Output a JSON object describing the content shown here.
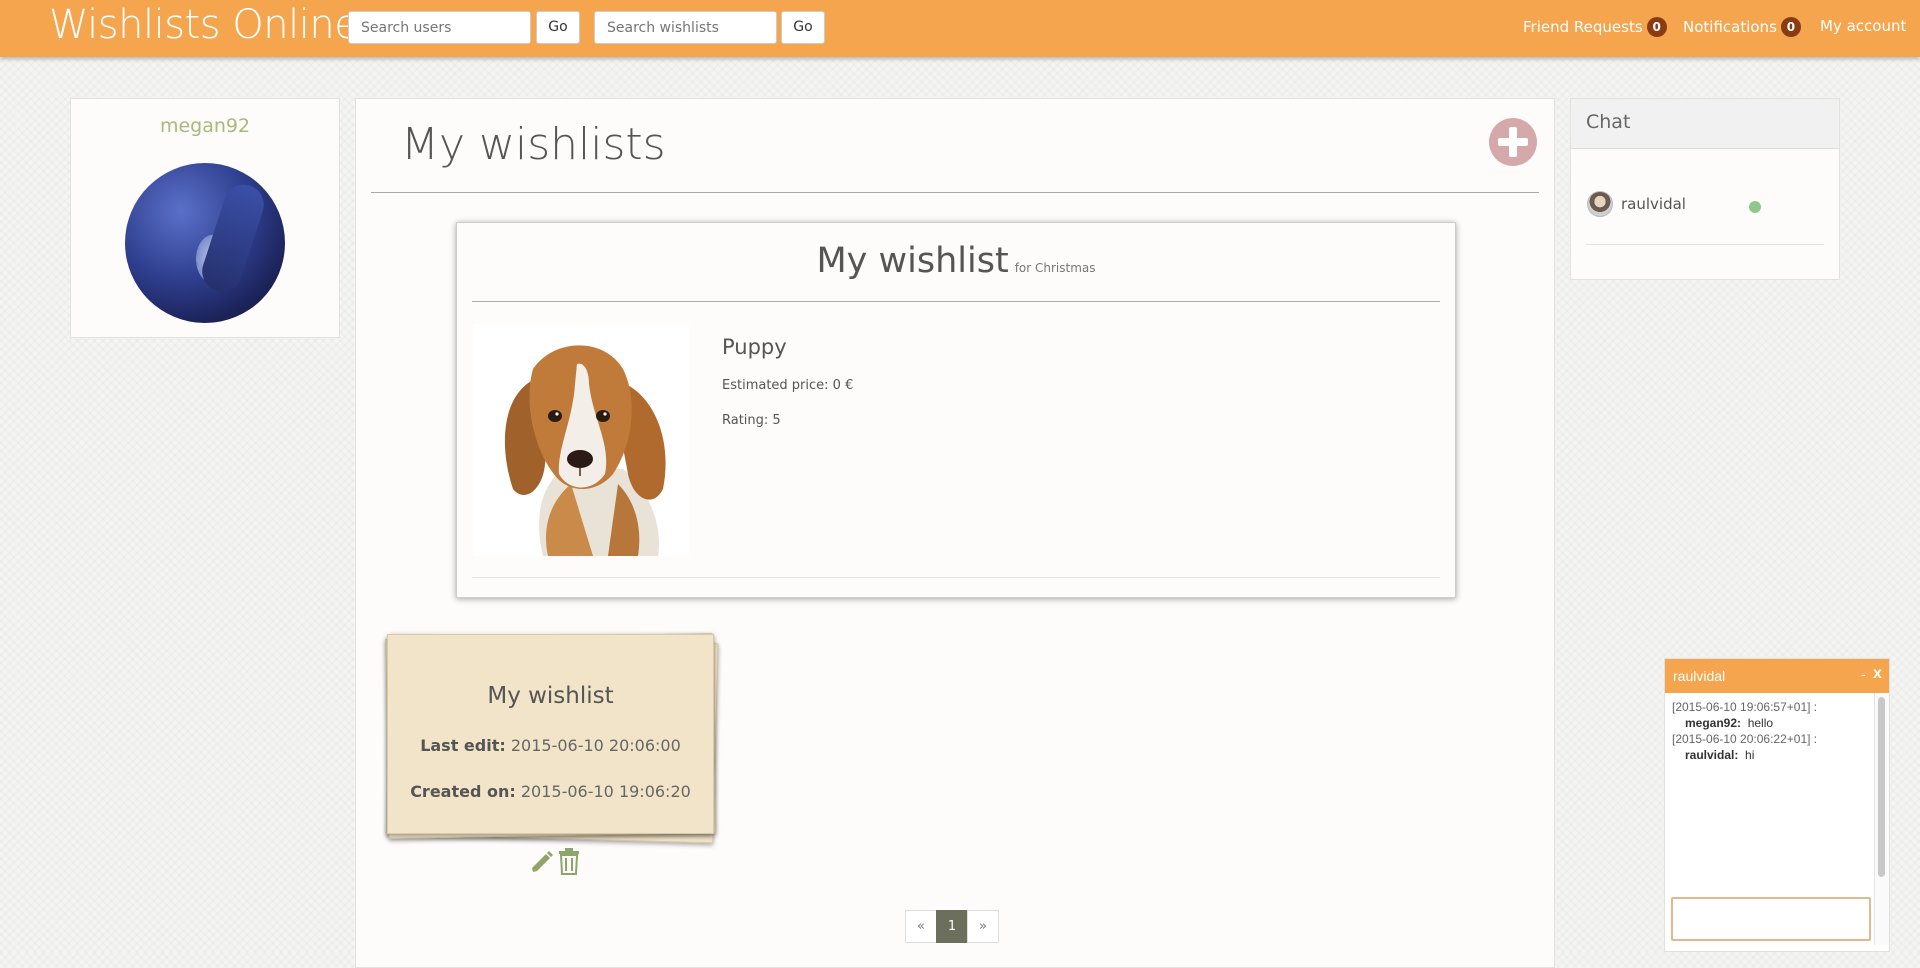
{
  "header": {
    "brand": "Wishlists Online",
    "search_users_placeholder": "Search users",
    "search_wishlists_placeholder": "Search wishlists",
    "go_label": "Go",
    "friend_requests_label": "Friend Requests",
    "friend_requests_count": "0",
    "notifications_label": "Notifications",
    "notifications_count": "0",
    "my_account_label": "My account"
  },
  "profile": {
    "username": "megan92"
  },
  "main": {
    "title": "My wishlists",
    "featured": {
      "title": "My wishlist",
      "subtitle": "for Christmas",
      "item": {
        "name": "Puppy",
        "price": "Estimated price: 0 €",
        "rating": "Rating: 5"
      }
    },
    "card": {
      "title": "My wishlist",
      "last_edit_label": "Last edit:",
      "last_edit_value": "2015-06-10 20:06:00",
      "created_label": "Created on:",
      "created_value": "2015-06-10 19:06:20"
    },
    "pagination": {
      "prev": "«",
      "current": "1",
      "next": "»"
    }
  },
  "chat": {
    "title": "Chat",
    "contact": {
      "name": "raulvidal",
      "status_color": "#8fc98a"
    }
  },
  "chatbox": {
    "title": "raulvidal",
    "minimize": "-",
    "close": "x",
    "messages": [
      {
        "timestamp": "[2015-06-10 19:06:57+01] :",
        "author": "megan92:",
        "text": "hello"
      },
      {
        "timestamp": "[2015-06-10 20:06:22+01] :",
        "author": "raulvidal:",
        "text": "hi"
      }
    ],
    "input_value": ""
  },
  "colors": {
    "header": "#f6a54f",
    "badge": "#8a3b12",
    "accent_green": "#a8b97a",
    "note_card": "#f2e4c8"
  }
}
